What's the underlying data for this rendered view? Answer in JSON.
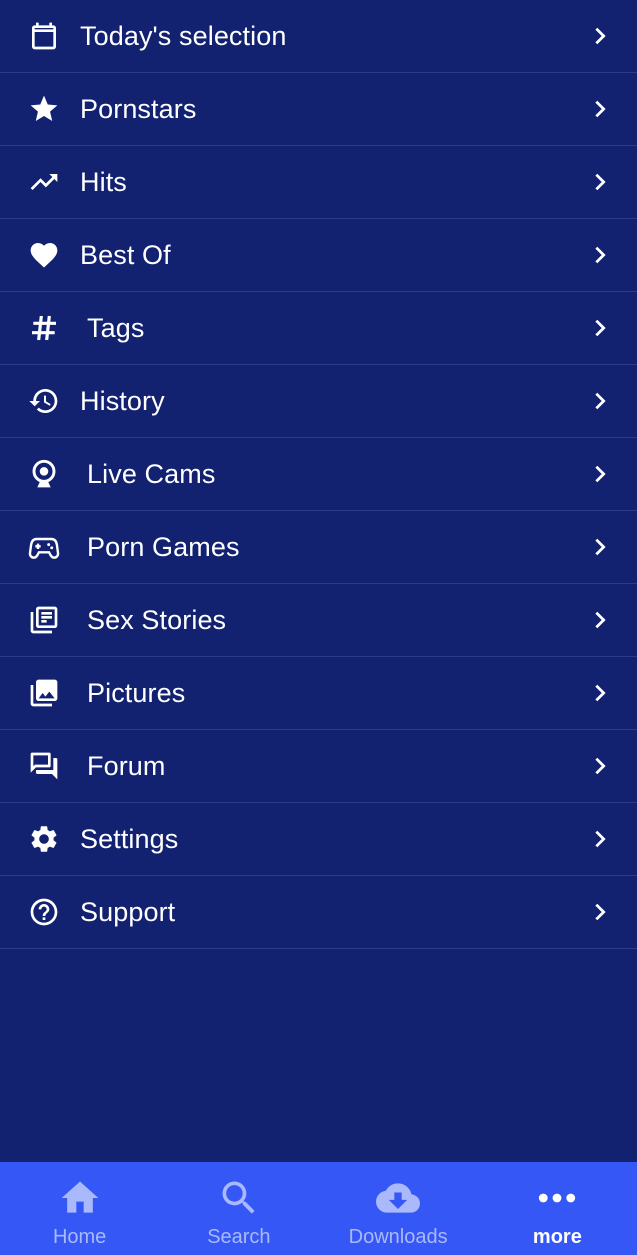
{
  "menu": {
    "items": [
      {
        "label": "Today's selection",
        "icon": "calendar-icon"
      },
      {
        "label": "Pornstars",
        "icon": "star-icon"
      },
      {
        "label": "Hits",
        "icon": "trending-up-icon"
      },
      {
        "label": "Best Of",
        "icon": "heart-icon"
      },
      {
        "label": "Tags",
        "icon": "hashtag-icon"
      },
      {
        "label": "History",
        "icon": "history-icon"
      },
      {
        "label": "Live Cams",
        "icon": "webcam-icon"
      },
      {
        "label": "Porn Games",
        "icon": "gamepad-icon"
      },
      {
        "label": "Sex Stories",
        "icon": "article-icon"
      },
      {
        "label": "Pictures",
        "icon": "photo-library-icon"
      },
      {
        "label": "Forum",
        "icon": "forum-icon"
      },
      {
        "label": "Settings",
        "icon": "gear-icon"
      },
      {
        "label": "Support",
        "icon": "help-circle-icon"
      }
    ]
  },
  "tabbar": {
    "tabs": [
      {
        "label": "Home",
        "icon": "home-icon"
      },
      {
        "label": "Search",
        "icon": "search-icon"
      },
      {
        "label": "Downloads",
        "icon": "cloud-download-icon"
      },
      {
        "label": "more",
        "icon": "more-dots-icon"
      }
    ],
    "active": "more"
  },
  "colors": {
    "background": "#122271",
    "divider": "#2a3a8e",
    "tabbar": "#3557f5",
    "tab_inactive": "#a9b9fb",
    "text": "#ffffff"
  }
}
